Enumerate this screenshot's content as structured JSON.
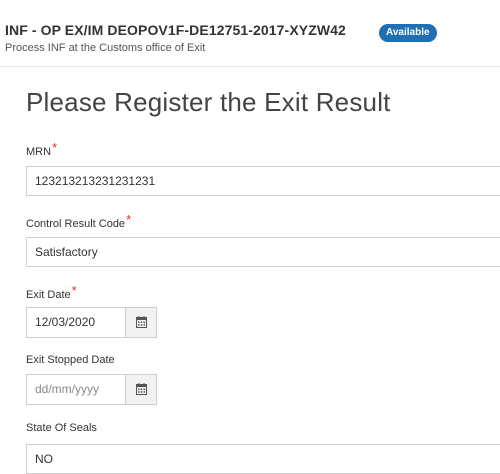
{
  "header": {
    "title": "INF - OP EX/IM DEOPOV1F-DE12751-2017-XYZW42",
    "subtitle": "Process INF at the Customs office of Exit",
    "status_badge": "Available"
  },
  "form": {
    "title": "Please Register the Exit Result",
    "required_marker": "*",
    "fields": {
      "mrn": {
        "label": "MRN",
        "value": "123213213231231231"
      },
      "control_result_code": {
        "label": "Control Result Code",
        "value": "Satisfactory"
      },
      "exit_date": {
        "label": "Exit Date",
        "value": "12/03/2020",
        "icon": "calendar-icon"
      },
      "exit_stopped_date": {
        "label": "Exit Stopped Date",
        "placeholder": "dd/mm/yyyy",
        "icon": "calendar-icon"
      },
      "state_of_seals": {
        "label": "State Of Seals",
        "value": "NO"
      }
    }
  },
  "colors": {
    "badge": "#1f6fb5",
    "required": "#e0301e",
    "border": "#cfcfcf"
  }
}
